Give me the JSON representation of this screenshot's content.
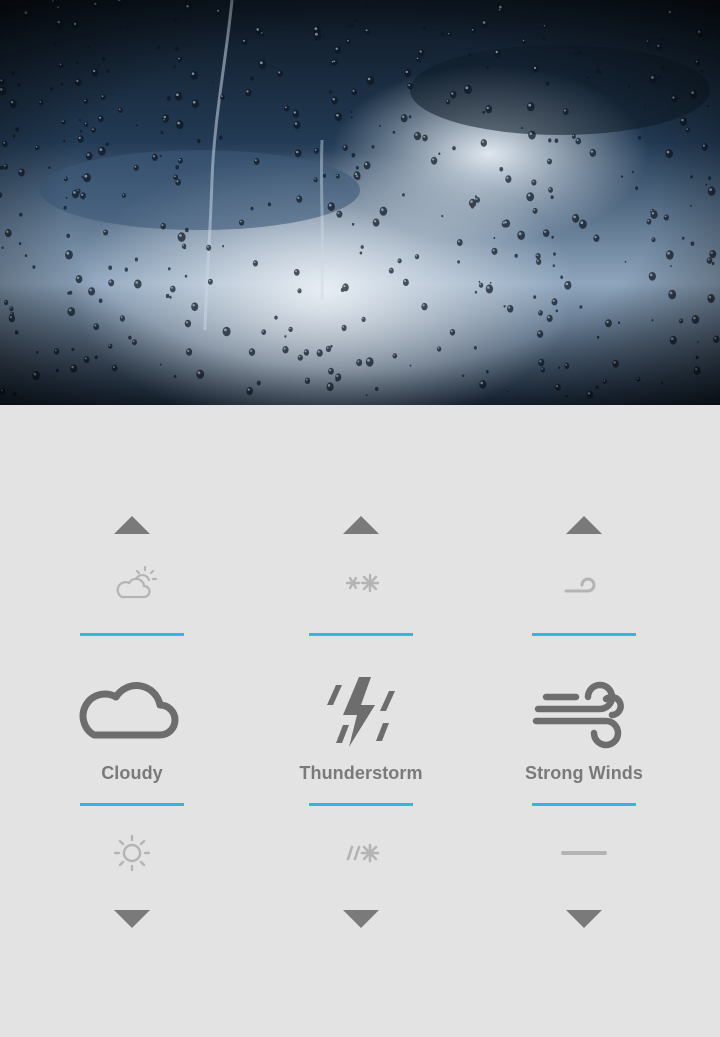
{
  "colors": {
    "accent": "#33b5e5",
    "selected_icon": "#6d6d6d",
    "faded_icon": "#b4b4b4",
    "arrow": "#7a7a7a",
    "label": "#7a7a7a",
    "background": "#e3e3e3"
  },
  "header": {
    "photo": "rain-on-window-photo"
  },
  "pickers": [
    {
      "prev_icon": "partly-sunny-icon",
      "current_icon": "cloud-icon",
      "current_label": "Cloudy",
      "next_icon": "sun-icon"
    },
    {
      "prev_icon": "snow-icon",
      "current_icon": "thunderstorm-icon",
      "current_label": "Thunderstorm",
      "next_icon": "sleet-icon"
    },
    {
      "prev_icon": "breeze-icon",
      "current_icon": "strong-wind-icon",
      "current_label": "Strong Winds",
      "next_icon": "fog-line-icon"
    }
  ]
}
